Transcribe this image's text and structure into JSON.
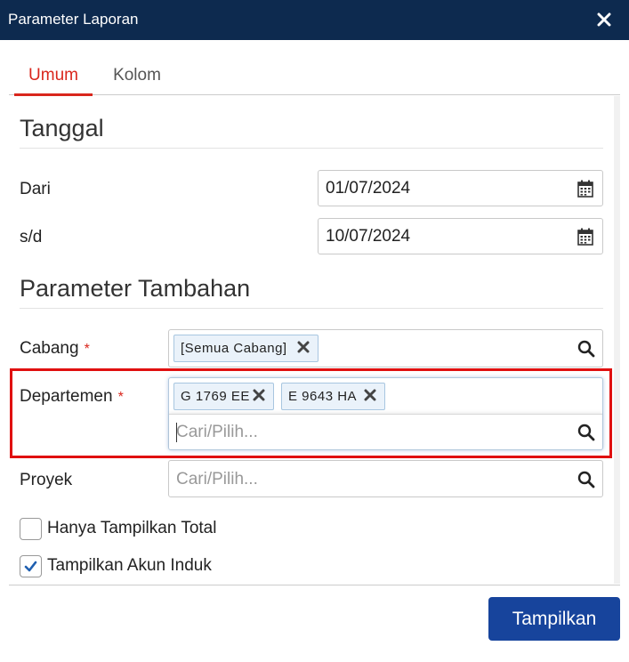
{
  "window": {
    "title": "Parameter Laporan"
  },
  "tabs": [
    {
      "label": "Umum",
      "active": true
    },
    {
      "label": "Kolom",
      "active": false
    }
  ],
  "tanggal": {
    "heading": "Tanggal",
    "from_label": "Dari",
    "from_value": "01/07/2024",
    "to_label": "s/d",
    "to_value": "10/07/2024"
  },
  "parameter": {
    "heading": "Parameter Tambahan",
    "required_mark": "*",
    "cabang": {
      "label": "Cabang",
      "tags": [
        "[Semua Cabang]"
      ]
    },
    "departemen": {
      "label": "Departemen",
      "tags": [
        "G 1769 EE",
        "E 9643 HA"
      ],
      "placeholder": "Cari/Pilih..."
    },
    "proyek": {
      "label": "Proyek",
      "placeholder": "Cari/Pilih..."
    }
  },
  "options": {
    "only_total": {
      "label": "Hanya Tampilkan Total",
      "checked": false
    },
    "parent_account": {
      "label": "Tampilkan Akun Induk",
      "checked": true
    }
  },
  "footer": {
    "submit_label": "Tampilkan"
  },
  "colors": {
    "titlebar": "#0d2a4f",
    "accent": "#d9261c",
    "primary": "#17449c",
    "highlight": "#e01010"
  }
}
